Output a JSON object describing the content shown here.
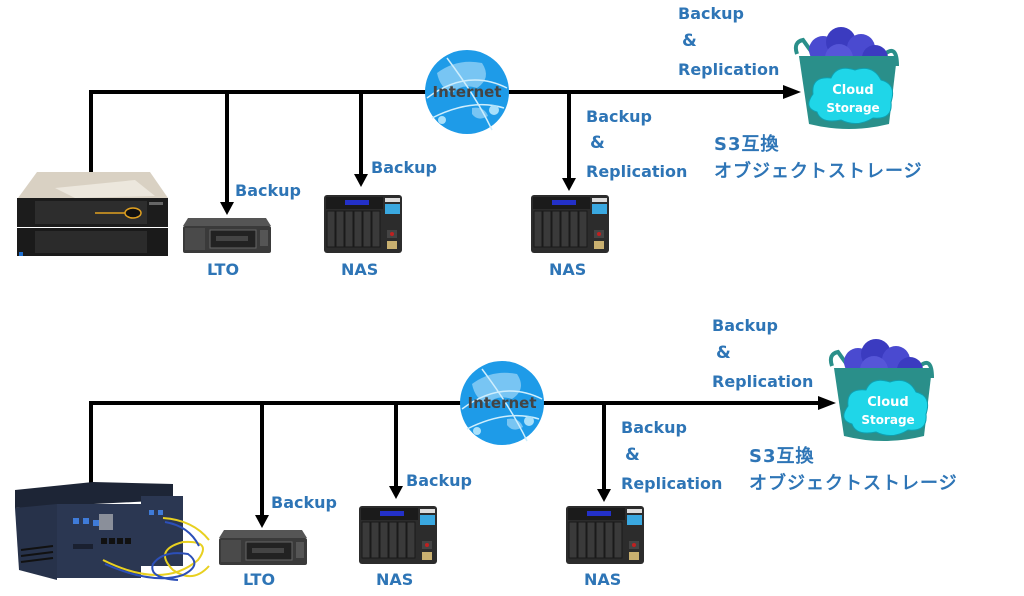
{
  "diagrams": [
    {
      "id": "top",
      "source_device": "rack-server",
      "internet_label": "Internet",
      "targets": [
        {
          "device": "LTO",
          "label": "LTO",
          "action": "Backup"
        },
        {
          "device": "NAS",
          "label": "NAS",
          "action": "Backup"
        },
        {
          "device": "NAS",
          "label": "NAS",
          "action_lines": [
            "Backup",
            "&",
            "Replication"
          ]
        },
        {
          "device": "Cloud Storage",
          "action_lines": [
            "Backup",
            "&",
            "Replication"
          ],
          "cloud_lines": [
            "Cloud",
            "Storage"
          ],
          "caption_lines": [
            "S3互換",
            "オブジェクトストレージ"
          ]
        }
      ]
    },
    {
      "id": "bottom",
      "source_device": "edge-server-pair",
      "internet_label": "Internet",
      "targets": [
        {
          "device": "LTO",
          "label": "LTO",
          "action": "Backup"
        },
        {
          "device": "NAS",
          "label": "NAS",
          "action": "Backup"
        },
        {
          "device": "NAS",
          "label": "NAS",
          "action_lines": [
            "Backup",
            "&",
            "Replication"
          ]
        },
        {
          "device": "Cloud Storage",
          "action_lines": [
            "Backup",
            "&",
            "Replication"
          ],
          "cloud_lines": [
            "Cloud",
            "Storage"
          ],
          "caption_lines": [
            "S3互換",
            "オブジェクトストレージ"
          ]
        }
      ]
    }
  ],
  "colors": {
    "label_blue": "#2e75b6",
    "line": "#000000",
    "globe_blue": "#1e9be8",
    "cloud_cyan": "#1fd6e8",
    "bucket_teal": "#2a8f8a"
  }
}
